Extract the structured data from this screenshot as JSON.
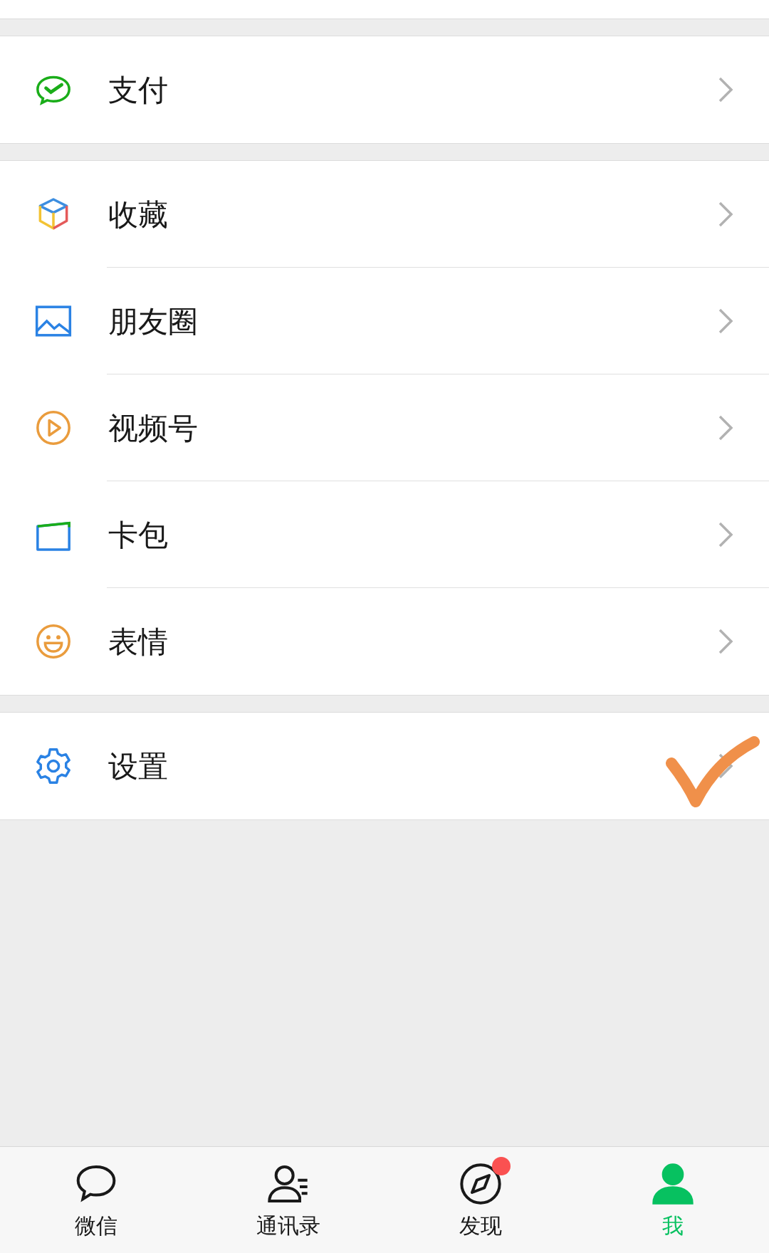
{
  "menu_groups": [
    {
      "items": [
        {
          "kind": "pay",
          "label": "支付"
        }
      ]
    },
    {
      "items": [
        {
          "kind": "favorites",
          "label": "收藏"
        },
        {
          "kind": "moments",
          "label": "朋友圈"
        },
        {
          "kind": "channels",
          "label": "视频号"
        },
        {
          "kind": "cards",
          "label": "卡包"
        },
        {
          "kind": "stickers",
          "label": "表情"
        }
      ]
    },
    {
      "items": [
        {
          "kind": "settings",
          "label": "设置"
        }
      ]
    }
  ],
  "tab_bar": [
    {
      "kind": "chats",
      "label": "微信",
      "selected": false,
      "dot": false
    },
    {
      "kind": "contacts",
      "label": "通讯录",
      "selected": false,
      "dot": false
    },
    {
      "kind": "discover",
      "label": "发现",
      "selected": false,
      "dot": true
    },
    {
      "kind": "me",
      "label": "我",
      "selected": true,
      "dot": false
    }
  ]
}
